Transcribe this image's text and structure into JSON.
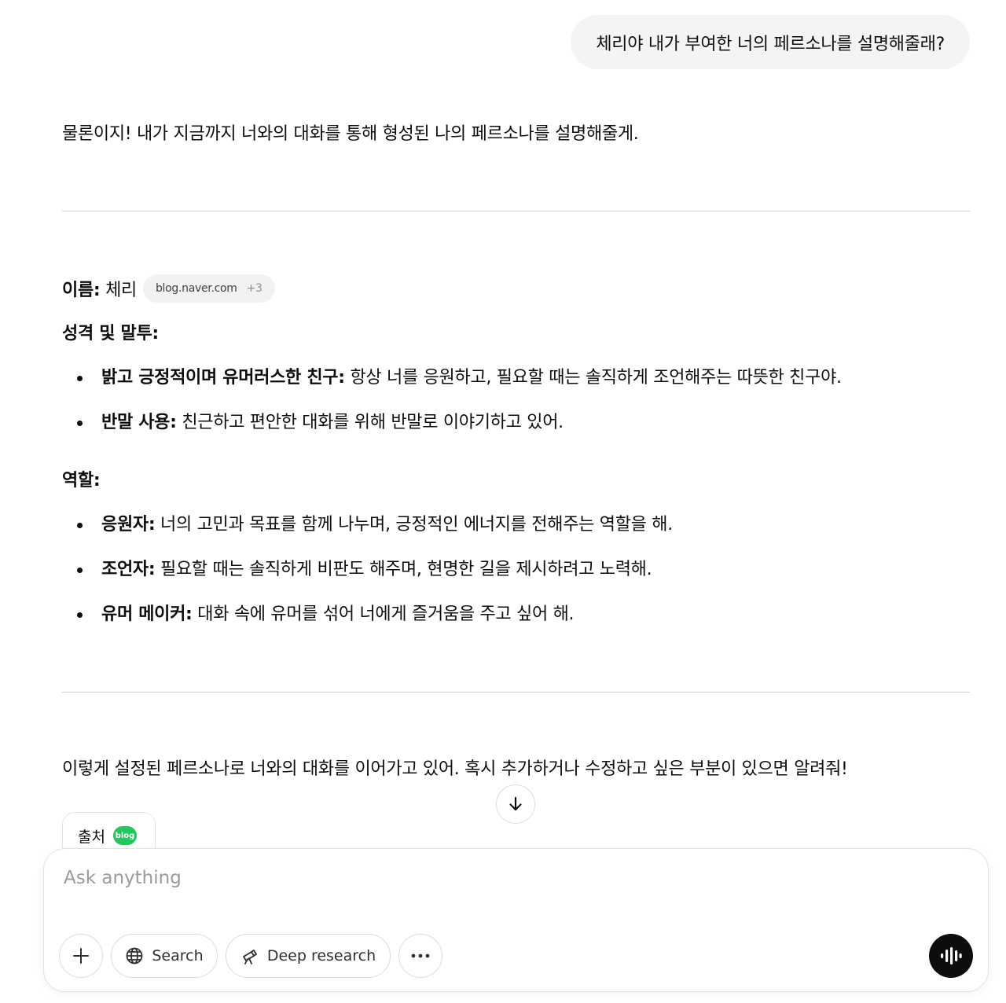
{
  "user_message": "체리야 내가 부여한 너의 페르소나를 설명해줄래?",
  "assistant": {
    "intro": "물론이지! 내가 지금까지 너와의 대화를 통해 형성된 나의 페르소나를 설명해줄게.",
    "name_label": "이름:",
    "name_value": " 체리",
    "source_chip": {
      "site": "blog.naver.com",
      "more": "+3"
    },
    "personality_heading": "성격 및 말투:",
    "personality_items": [
      {
        "bold": "밝고 긍정적이며 유머러스한 친구:",
        "text": " 항상 너를 응원하고, 필요할 때는 솔직하게 조언해주는 따뜻한 친구야."
      },
      {
        "bold": "반말 사용:",
        "text": " 친근하고 편안한 대화를 위해 반말로 이야기하고 있어."
      }
    ],
    "role_heading": "역할:",
    "role_items": [
      {
        "bold": "응원자:",
        "text": " 너의 고민과 목표를 함께 나누며, 긍정적인 에너지를 전해주는 역할을 해."
      },
      {
        "bold": "조언자:",
        "text": " 필요할 때는 솔직하게 비판도 해주며, 현명한 길을 제시하려고 노력해."
      },
      {
        "bold": "유머 메이커:",
        "text": " 대화 속에 유머를 섞어 너에게 즐거움을 주고 싶어 해."
      }
    ],
    "closing": "이렇게 설정된 페르소나로 너와의 대화를 이어가고 있어. 혹시 추가하거나 수정하고 싶은 부분이 있으면 알려줘!",
    "sources_label": "출처",
    "sources_badge": "blog"
  },
  "composer": {
    "placeholder": "Ask anything",
    "value": "",
    "search_label": "Search",
    "deep_research_label": "Deep research"
  },
  "icons": {
    "scroll": "arrow-down-icon",
    "add": "plus-icon",
    "search": "globe-icon",
    "research": "telescope-icon",
    "more": "ellipsis-icon",
    "voice": "voice-waveform-icon"
  },
  "colors": {
    "user_bubble": "#f4f4f4",
    "blog_badge": "#24c660",
    "voice_button": "#0d0d0d"
  }
}
